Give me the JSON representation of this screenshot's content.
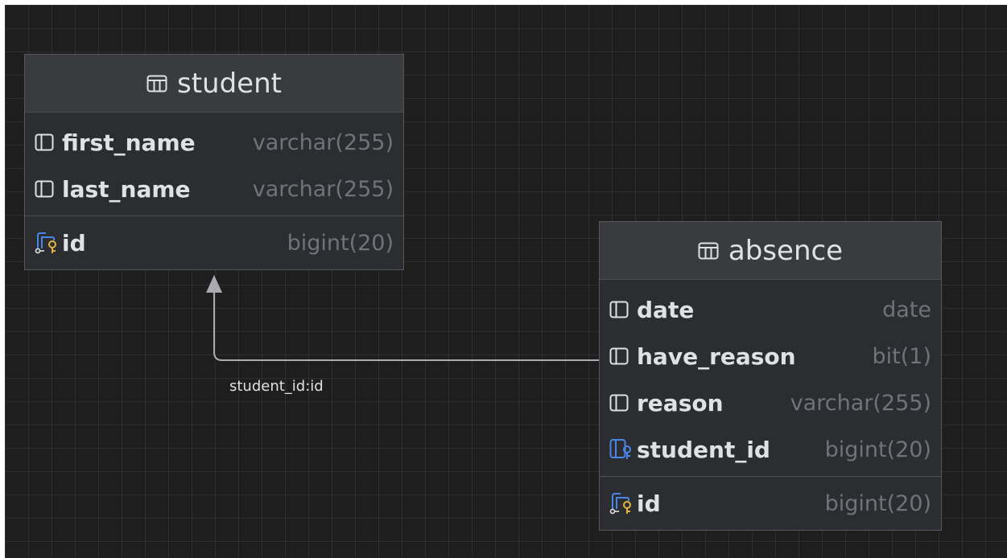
{
  "tables": {
    "student": {
      "name": "student",
      "columns": [
        {
          "name": "first_name",
          "type": "varchar(255)",
          "icon": "column-icon"
        },
        {
          "name": "last_name",
          "type": "varchar(255)",
          "icon": "column-icon"
        }
      ],
      "keys": [
        {
          "name": "id",
          "type": "bigint(20)",
          "icon": "primary-key-icon"
        }
      ]
    },
    "absence": {
      "name": "absence",
      "columns": [
        {
          "name": "date",
          "type": "date",
          "icon": "column-icon"
        },
        {
          "name": "have_reason",
          "type": "bit(1)",
          "icon": "column-icon"
        },
        {
          "name": "reason",
          "type": "varchar(255)",
          "icon": "column-icon"
        },
        {
          "name": "student_id",
          "type": "bigint(20)",
          "icon": "foreign-key-icon"
        }
      ],
      "keys": [
        {
          "name": "id",
          "type": "bigint(20)",
          "icon": "primary-key-icon"
        }
      ]
    }
  },
  "relation": {
    "label": "student_id:id",
    "from": "absence.student_id",
    "to": "student.id"
  },
  "colors": {
    "background": "#1e1e1e",
    "table_body": "#2b2d30",
    "table_header": "#3a3b3e",
    "text": "#dfe1e5",
    "type_text": "#6f737a",
    "key_gold": "#e3b341",
    "key_blue": "#4a86e8",
    "relation_line": "#a9abb0"
  }
}
